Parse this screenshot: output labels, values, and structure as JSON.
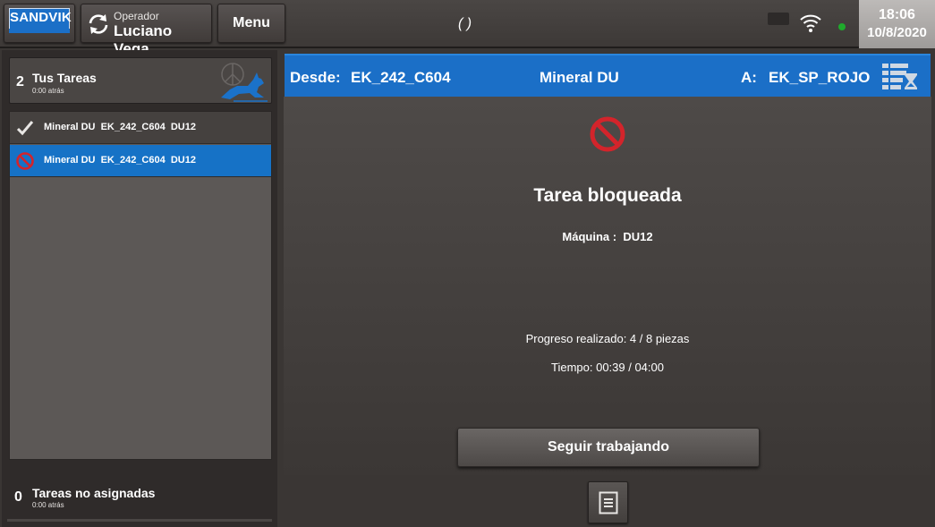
{
  "header": {
    "logo_text": "SANDVIK",
    "operator_label": "Operador",
    "operator_name": "Luciano Vega",
    "menu_label": "Menu",
    "center_status": "( )",
    "time": "18:06",
    "date": "10/8/2020",
    "connection_status_color": "#1faa2c"
  },
  "sidebar": {
    "your_tasks": {
      "count": "2",
      "title": "Tus Tareas",
      "subtitle": "0:00 atrás"
    },
    "tasks": [
      {
        "label": "Mineral DU  EK_242_C604  DU12",
        "status_icon": "check-icon"
      },
      {
        "label": "Mineral DU  EK_242_C604  DU12",
        "status_icon": "blocked-icon",
        "selected": true
      }
    ],
    "unassigned": {
      "count": "0",
      "title": "Tareas no asignadas",
      "subtitle": "0:00 atrás"
    }
  },
  "route": {
    "from_label": "Desde:",
    "from_value": "EK_242_C604",
    "material": "Mineral DU",
    "to_label": "A:",
    "to_value": "EK_SP_ROJO"
  },
  "task_detail": {
    "status_title": "Tarea bloqueada",
    "machine_label": "Máquina :",
    "machine_value": "DU12",
    "progress_text": "Progreso realizado: 4 / 8 piezas",
    "time_text": "Tiempo: 00:39 / 04:00",
    "continue_button": "Seguir trabajando"
  },
  "colors": {
    "accent_blue": "#1b6fc7",
    "blocked_red": "#d3242b",
    "background": "#3a3634"
  }
}
